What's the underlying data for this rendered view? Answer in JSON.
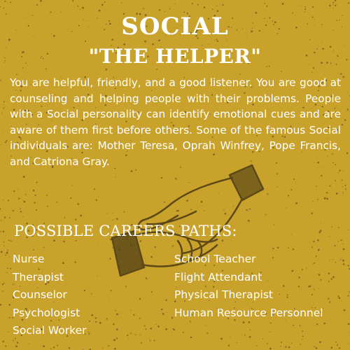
{
  "header": {
    "title": "SOCIAL",
    "subtitle": "\"THE HELPER\""
  },
  "description": "You are helpful, friendly, and a good listener. You are good at counseling and helping people with their problems. People with a Social personality can identify emotional cues and are aware of them first before others. Some of the famous Social individuals are: Mother Teresa, Oprah Winfrey, Pope Francis, and Catriona Gray.",
  "careers": {
    "heading": "POSSIBLE CAREERS PATHS:",
    "left_column": [
      "Nurse",
      "Therapist",
      "Counselor",
      "Psychologist",
      "Social Worker"
    ],
    "right_column": [
      "School Teacher",
      "Flight Attendant",
      "Physical Therapist",
      "Human Resource Personnel"
    ]
  },
  "colors": {
    "background": "#c9a22c",
    "text": "#ffffff",
    "illustration": "#4a3a14"
  },
  "illustration": "handshake-icon"
}
